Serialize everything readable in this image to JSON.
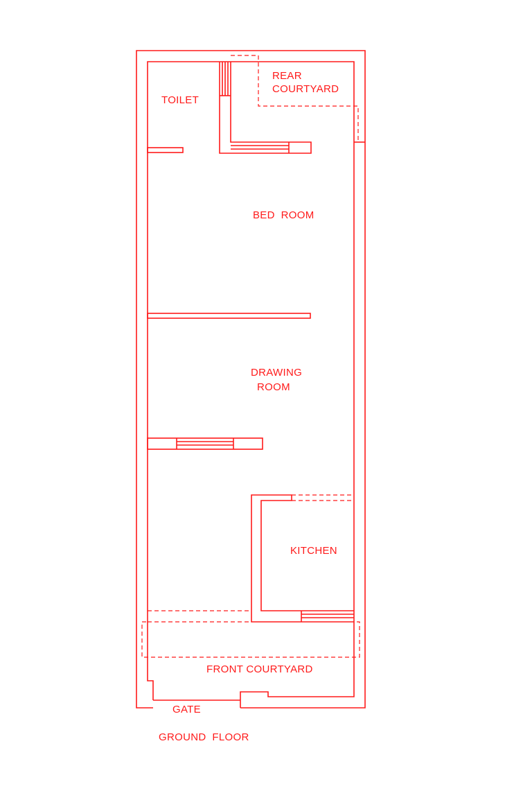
{
  "plan": {
    "labels": {
      "toilet": "TOILET",
      "rear_courtyard_line1": "REAR",
      "rear_courtyard_line2": "COURTYARD",
      "bed_room": "BED  ROOM",
      "drawing_room_line1": "DRAWING",
      "drawing_room_line2": "ROOM",
      "kitchen": "KITCHEN",
      "front_courtyard": "FRONT COURTYARD",
      "gate": "GATE",
      "floor_title": "GROUND  FLOOR"
    },
    "colors": {
      "line": "#ff1a1a",
      "background": "#ffffff"
    }
  }
}
